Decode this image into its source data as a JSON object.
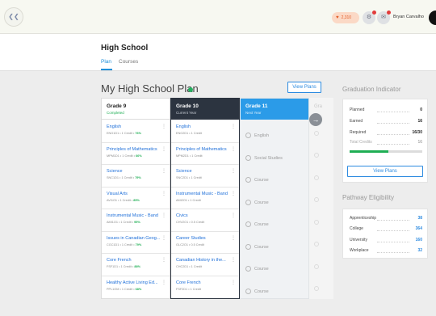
{
  "topbar": {
    "menu_icon": "chevron-left-icon",
    "credits": "2,310",
    "notification_icon": "notification-icon",
    "inbox_icon": "inbox-icon",
    "user_name": "Bryan Carvalho"
  },
  "page": {
    "title": "High School",
    "tabs": [
      {
        "label": "Plan",
        "active": true
      },
      {
        "label": "Courses",
        "active": false
      }
    ]
  },
  "plan": {
    "title": "My High School Plan",
    "status_color": "#27ae60",
    "view_plans_label": "View Plans"
  },
  "grades": [
    {
      "label": "Grade 9",
      "subtitle": "Completed",
      "courses": [
        {
          "name": "English",
          "code": "ENG1D1",
          "credit": "1 Credit",
          "pct": "76%"
        },
        {
          "name": "Principles of Mathematics",
          "code": "MPM1D1",
          "credit": "1 Credit",
          "pct": "66%"
        },
        {
          "name": "Science",
          "code": "SNC1D1",
          "credit": "1 Credit",
          "pct": "79%"
        },
        {
          "name": "Visual Arts",
          "code": "AVI1O1",
          "credit": "1 Credit",
          "pct": "85%"
        },
        {
          "name": "Instrumental Music - Band",
          "code": "AMI1O1",
          "credit": "1 Credit",
          "pct": "95%"
        },
        {
          "name": "Issues in Canadian Geog...",
          "code": "CGC1D1",
          "credit": "1 Credit",
          "pct": "79%"
        },
        {
          "name": "Core French",
          "code": "FSF1D1",
          "credit": "1 Credit",
          "pct": "88%"
        },
        {
          "name": "Healthy Active Living Ed...",
          "code": "PPL1OM",
          "credit": "1 Credit",
          "pct": "68%"
        }
      ]
    },
    {
      "label": "Grade 10",
      "subtitle": "Current Year",
      "courses": [
        {
          "name": "English",
          "code": "ENG2D1",
          "credit": "1 Credit"
        },
        {
          "name": "Principles of Mathematics",
          "code": "MPM2D1",
          "credit": "1 Credit"
        },
        {
          "name": "Science",
          "code": "SNC2D1",
          "credit": "1 Credit"
        },
        {
          "name": "Instrumental Music - Band",
          "code": "AMI2O1",
          "credit": "1 Credit"
        },
        {
          "name": "Civics",
          "code": "CHV2O1",
          "credit": "0.5 Credit"
        },
        {
          "name": "Career Studies",
          "code": "GLC2O1",
          "credit": "0.5 Credit"
        },
        {
          "name": "Canadian History in the...",
          "code": "CHC2D1",
          "credit": "1 Credit"
        },
        {
          "name": "Core French",
          "code": "FSF2D1",
          "credit": "1 Credit"
        }
      ]
    },
    {
      "label": "Grade 11",
      "subtitle": "Next Year",
      "slots": [
        "English",
        "Social Studies",
        "Course",
        "Course",
        "Course",
        "Course",
        "Course",
        "Course"
      ]
    },
    {
      "label": "Gra"
    }
  ],
  "graduation": {
    "title": "Graduation Indicator",
    "rows": [
      {
        "label": "Planned",
        "value": "0"
      },
      {
        "label": "Earned",
        "value": "16"
      },
      {
        "label": "Required",
        "value": "16/30"
      },
      {
        "label": "Total Credits",
        "value": "16"
      }
    ],
    "progress": 0.53,
    "progress_color": "#1fae54",
    "button_label": "View Plans"
  },
  "pathway": {
    "title": "Pathway Eligibility",
    "rows": [
      {
        "label": "Apprenticeship",
        "value": "38"
      },
      {
        "label": "College",
        "value": "364"
      },
      {
        "label": "University",
        "value": "160"
      },
      {
        "label": "Workplace",
        "value": "32"
      }
    ]
  }
}
